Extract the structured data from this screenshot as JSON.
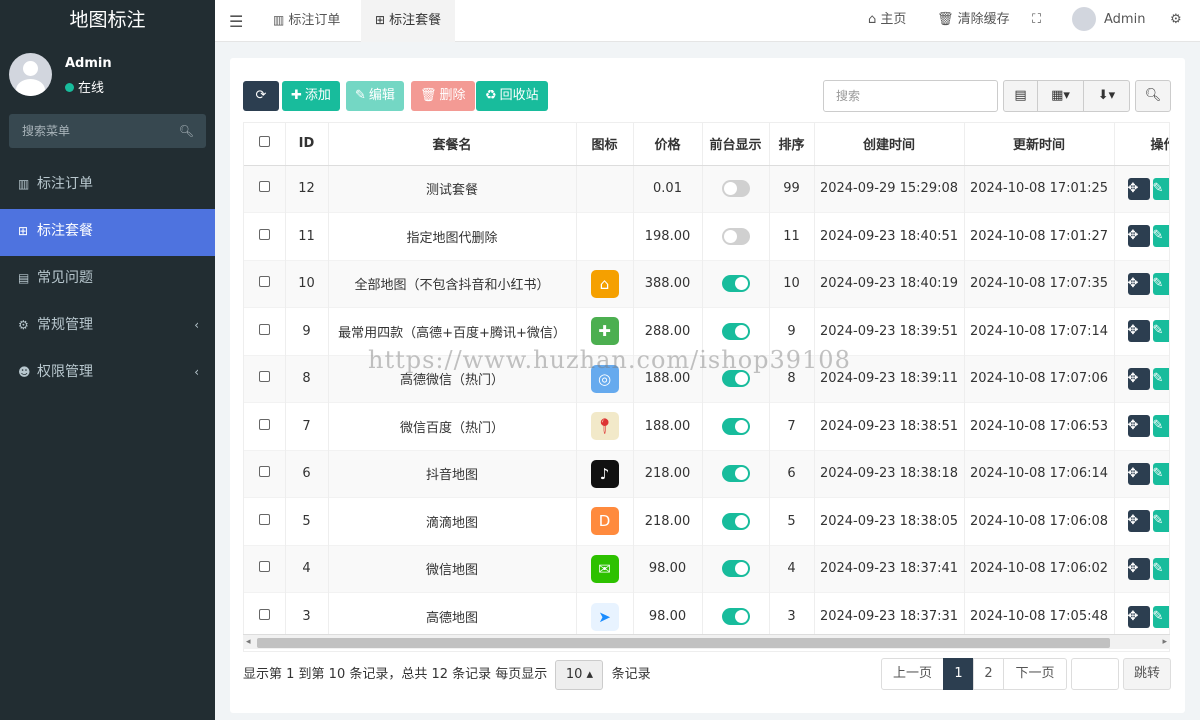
{
  "app": {
    "logo": "地图标注"
  },
  "user": {
    "name": "Admin",
    "status": "在线"
  },
  "sidebar": {
    "search_placeholder": "搜索菜单",
    "items": [
      {
        "label": "标注订单",
        "icon": "map-icon"
      },
      {
        "label": "标注套餐",
        "icon": "sitemap-icon",
        "active": true
      },
      {
        "label": "常见问题",
        "icon": "book-icon"
      },
      {
        "label": "常规管理",
        "icon": "gears-icon",
        "has_arrow": true
      },
      {
        "label": "权限管理",
        "icon": "users-icon",
        "has_arrow": true
      }
    ]
  },
  "topbar": {
    "tabs": [
      {
        "label": "标注订单"
      },
      {
        "label": "标注套餐"
      }
    ],
    "home": "主页",
    "clear_cache": "清除缓存",
    "user": "Admin"
  },
  "toolbar": {
    "add": "添加",
    "edit": "编辑",
    "delete": "删除",
    "recycle": "回收站",
    "search_placeholder": "搜索"
  },
  "table": {
    "headers": [
      "ID",
      "套餐名",
      "图标",
      "价格",
      "前台显示",
      "排序",
      "创建时间",
      "更新时间",
      "操作"
    ],
    "rows": [
      {
        "id": "12",
        "name": "测试套餐",
        "icon": "",
        "price": "0.01",
        "show": false,
        "sort": "99",
        "created": "2024-09-29 15:29:08",
        "updated": "2024-10-08 17:01:25"
      },
      {
        "id": "11",
        "name": "指定地图代删除",
        "icon": "",
        "price": "198.00",
        "show": false,
        "sort": "11",
        "created": "2024-09-23 18:40:51",
        "updated": "2024-10-08 17:01:27"
      },
      {
        "id": "10",
        "name": "全部地图（不包含抖音和小红书）",
        "icon": "map-all-icon",
        "price": "388.00",
        "show": true,
        "sort": "10",
        "created": "2024-09-23 18:40:19",
        "updated": "2024-10-08 17:07:35"
      },
      {
        "id": "9",
        "name": "最常用四款（高德+百度+腾讯+微信）",
        "icon": "four-maps-icon",
        "price": "288.00",
        "show": true,
        "sort": "9",
        "created": "2024-09-23 18:39:51",
        "updated": "2024-10-08 17:07:14"
      },
      {
        "id": "8",
        "name": "高德微信（热门）",
        "icon": "amap-wechat-icon",
        "price": "188.00",
        "show": true,
        "sort": "8",
        "created": "2024-09-23 18:39:11",
        "updated": "2024-10-08 17:07:06"
      },
      {
        "id": "7",
        "name": "微信百度（热门）",
        "icon": "wechat-baidu-icon",
        "price": "188.00",
        "show": true,
        "sort": "7",
        "created": "2024-09-23 18:38:51",
        "updated": "2024-10-08 17:06:53"
      },
      {
        "id": "6",
        "name": "抖音地图",
        "icon": "douyin-icon",
        "price": "218.00",
        "show": true,
        "sort": "6",
        "created": "2024-09-23 18:38:18",
        "updated": "2024-10-08 17:06:14"
      },
      {
        "id": "5",
        "name": "滴滴地图",
        "icon": "didi-icon",
        "price": "218.00",
        "show": true,
        "sort": "5",
        "created": "2024-09-23 18:38:05",
        "updated": "2024-10-08 17:06:08"
      },
      {
        "id": "4",
        "name": "微信地图",
        "icon": "wechat-icon",
        "price": "98.00",
        "show": true,
        "sort": "4",
        "created": "2024-09-23 18:37:41",
        "updated": "2024-10-08 17:06:02"
      },
      {
        "id": "3",
        "name": "高德地图",
        "icon": "amap-icon",
        "price": "98.00",
        "show": true,
        "sort": "3",
        "created": "2024-09-23 18:37:31",
        "updated": "2024-10-08 17:05:48"
      }
    ]
  },
  "pagination": {
    "info_prefix": "显示第 1 到第 10 条记录，总共 12 条记录 每页显示",
    "page_size": "10",
    "info_suffix": "条记录",
    "prev": "上一页",
    "pages": [
      "1",
      "2"
    ],
    "next": "下一页",
    "jump": "跳转"
  },
  "watermark": "https://www.huzhan.com/ishop39108",
  "colors": {
    "sidebar_bg": "#222d32",
    "active": "#4e73df",
    "primary": "#18bc9c",
    "dark": "#2c3e50"
  }
}
